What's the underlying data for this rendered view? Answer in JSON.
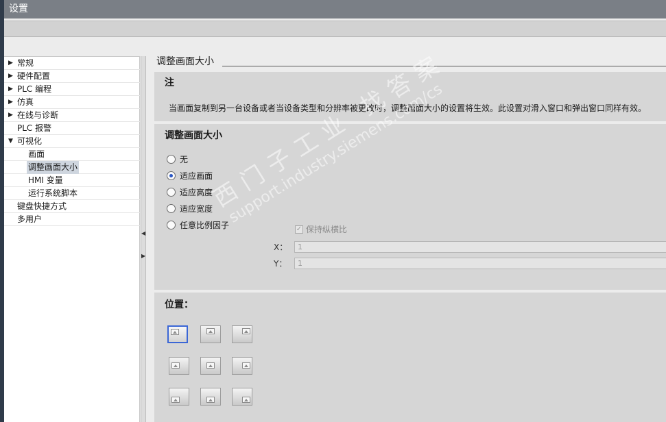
{
  "window": {
    "title": "设置"
  },
  "tree": {
    "items": [
      {
        "label": "常规",
        "expand": "▶",
        "level": 0
      },
      {
        "label": "硬件配置",
        "expand": "▶",
        "level": 0
      },
      {
        "label": "PLC 编程",
        "expand": "▶",
        "level": 0
      },
      {
        "label": "仿真",
        "expand": "▶",
        "level": 0
      },
      {
        "label": "在线与诊断",
        "expand": "▶",
        "level": 0
      },
      {
        "label": "PLC 报警",
        "expand": "",
        "level": 0
      },
      {
        "label": "可视化",
        "expand": "▼",
        "level": 0
      },
      {
        "label": "画面",
        "expand": "",
        "level": 1
      },
      {
        "label": "调整画面大小",
        "expand": "",
        "level": 1,
        "selected": true
      },
      {
        "label": "HMI 变量",
        "expand": "",
        "level": 1
      },
      {
        "label": "运行系统脚本",
        "expand": "",
        "level": 1
      },
      {
        "label": "键盘快捷方式",
        "expand": "",
        "level": 0
      },
      {
        "label": "多用户",
        "expand": "",
        "level": 0
      }
    ]
  },
  "splitter": {
    "collapse_glyph": "◀",
    "expand_glyph": "▶"
  },
  "content": {
    "title": "调整画面大小",
    "note": {
      "heading": "注",
      "text": "当画面复制到另一台设备或者当设备类型和分辨率被更改时，调整画面大小的设置将生效。此设置对滑入窗口和弹出窗口同样有效。"
    },
    "resize": {
      "heading": "调整画面大小",
      "options": [
        {
          "label": "无",
          "checked": false
        },
        {
          "label": "适应画面",
          "checked": true
        },
        {
          "label": "适应高度",
          "checked": false
        },
        {
          "label": "适应宽度",
          "checked": false
        },
        {
          "label": "任意比例因子",
          "checked": false
        }
      ],
      "keep_aspect": {
        "label": "保持纵横比",
        "checked": true,
        "enabled": false
      },
      "x": {
        "label": "X：",
        "value": "1"
      },
      "y": {
        "label": "Y：",
        "value": "1"
      }
    },
    "position": {
      "heading": "位置：",
      "selected": "top-left",
      "buttons": [
        "top-left",
        "top-center",
        "top-right",
        "middle-left",
        "middle-center",
        "middle-right",
        "bottom-left",
        "bottom-center",
        "bottom-right"
      ]
    }
  },
  "watermark": {
    "line1": "西门子工业 找答案",
    "line2": "support.industry.siemens.com/cs"
  }
}
